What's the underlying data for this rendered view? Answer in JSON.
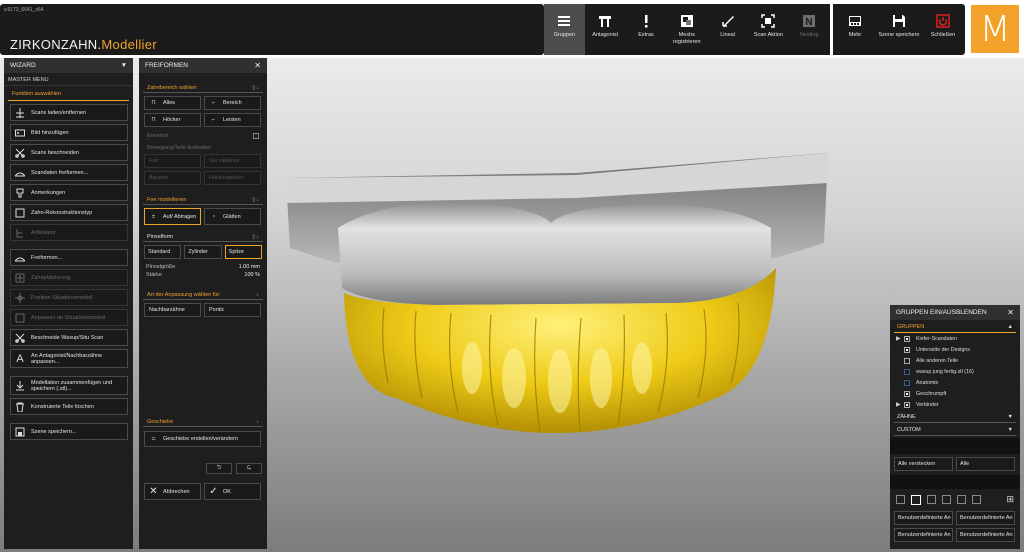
{
  "app": {
    "version": "v.6173_6641_x64",
    "brand": "ZIRKONZAHN",
    "dot": ".",
    "product": "Modellier",
    "logo_letter": "M"
  },
  "toolbar": [
    {
      "label": "Gruppen",
      "icon": "menu-lines-icon",
      "active": true
    },
    {
      "label": "Antagonist",
      "icon": "antagonist-icon"
    },
    {
      "label": "Extras",
      "icon": "exclamation-icon"
    },
    {
      "label": "Meshs registrieren",
      "icon": "mesh-register-icon"
    },
    {
      "label": "Lineal",
      "icon": "ruler-icon"
    },
    {
      "label": "Scan Aktion",
      "icon": "scan-frame-icon"
    },
    {
      "label": "Nesting",
      "icon": "nesting-icon",
      "disabled": true
    }
  ],
  "toolbar2": [
    {
      "label": "Mehr",
      "icon": "more-icon"
    },
    {
      "label": "Szene speichern",
      "icon": "save-icon"
    },
    {
      "label": "Schließen",
      "icon": "power-icon"
    }
  ],
  "wizard": {
    "title": "WIZARD",
    "master_menu": "MASTER MENU",
    "section": "Funktion auswählen",
    "items": [
      {
        "label": "Scans laden/entfernen",
        "icon": "scan-load-icon"
      },
      {
        "label": "Bild hinzufügen",
        "icon": "image-add-icon"
      },
      {
        "label": "Scans beschneiden",
        "icon": "scissors-icon"
      },
      {
        "label": "Scandaten freiformen...",
        "icon": "freeform-icon"
      },
      {
        "label": "Anmerkungen",
        "icon": "pin-icon"
      },
      {
        "label": "Zahn-Rekonstruktionstyp",
        "icon": "tooth-type-icon"
      },
      {
        "label": "Artikulator",
        "icon": "articulator-icon",
        "disabled": true
      },
      {
        "label": "Freiformen...",
        "icon": "freeform-icon"
      },
      {
        "label": "Zahnplatzierung",
        "icon": "tooth-placement-icon",
        "disabled": true
      },
      {
        "label": "Position Situationsmodell",
        "icon": "position-icon",
        "disabled": true
      },
      {
        "label": "Anpassen an Situationsmodell",
        "icon": "adapt-icon",
        "disabled": true
      },
      {
        "label": "Beschneide Waxup/Situ Scan",
        "icon": "scissors-icon"
      },
      {
        "label": "An Antagonist/Nachbarzähne anpassen...",
        "icon": "letter-a-icon"
      },
      {
        "label": "Modellation zusammenfügen und speichern (.stl)...",
        "icon": "merge-save-icon"
      },
      {
        "label": "Konstruierte Teile löschen",
        "icon": "trash-icon"
      },
      {
        "label": "Szene speichern...",
        "icon": "scene-save-icon"
      }
    ]
  },
  "freiformen": {
    "title": "FREIFORMEN",
    "zahnbereich": "Zahnbereich wählen",
    "zb_buttons": [
      {
        "label": "Alles",
        "icon": "bracket-all-icon"
      },
      {
        "label": "Bereich",
        "icon": "bracket-area-icon"
      },
      {
        "label": "Höcker",
        "icon": "cusp-icon"
      },
      {
        "label": "Leisten",
        "icon": "ridge-icon"
      }
    ],
    "erweitert": "Erweitert",
    "bewegung": "Bewegung/Teile festhalten",
    "move_buttons": [
      "Frei",
      "Nur okklusal",
      "Äquator",
      "Höckerspitzen"
    ],
    "frei_modellieren": "Frei modellieren",
    "fm_buttons": [
      {
        "label": "Auf/ Abtragen",
        "icon": "plus-minus-icon"
      },
      {
        "label": "Glätten",
        "icon": "drop-icon"
      }
    ],
    "pinselform": "Pinselform",
    "pinsel_buttons": [
      "Standard",
      "Zylinder",
      "Spitze"
    ],
    "groesse_label": "Pinselgröße",
    "groesse_value": "1.00",
    "groesse_unit": "mm",
    "staerke_label": "Stärke",
    "staerke_value": "100",
    "staerke_unit": "%",
    "anpassung": "Art der Anpassung wählen für:",
    "anpassung_buttons": [
      "Nachbarzähne",
      "Pontic"
    ],
    "geschiebe": "Geschiebe",
    "geschiebe_button": "Geschiebe erstellen/verändern",
    "cancel": "Abbrechen",
    "ok": "OK"
  },
  "groups": {
    "title": "GRUPPEN EIN/AUSBLENDEN",
    "section": "GRUPPEN",
    "items": [
      {
        "label": "Kiefer-Scandaten",
        "checked": true,
        "arrow": true
      },
      {
        "label": "Unterseite der Designs",
        "checked": true
      },
      {
        "label": "Alle anderen Teile",
        "checked": false
      },
      {
        "label": "waxup jung fertig.stl (16)",
        "checked": false,
        "blue": true
      },
      {
        "label": "Anatomie",
        "checked": false,
        "blue": true
      },
      {
        "label": "Geschrumpft",
        "checked": true
      },
      {
        "label": "Verbinder",
        "checked": true,
        "arrow": true
      }
    ],
    "zaehne": "ZÄHNE",
    "custom": "CUSTOM",
    "hide_all": "Alle verstecken",
    "all": "Alle",
    "user_defined": [
      "Benutzerdefinierte An",
      "Benutzerdefinierte An",
      "Benutzerdefinierte An",
      "Benutzerdefinierte An"
    ]
  },
  "colors": {
    "accent": "#f0a22e",
    "panel": "#1e1e1e",
    "gingiva": "#c8c8c8",
    "teeth": "#e8c21a"
  }
}
